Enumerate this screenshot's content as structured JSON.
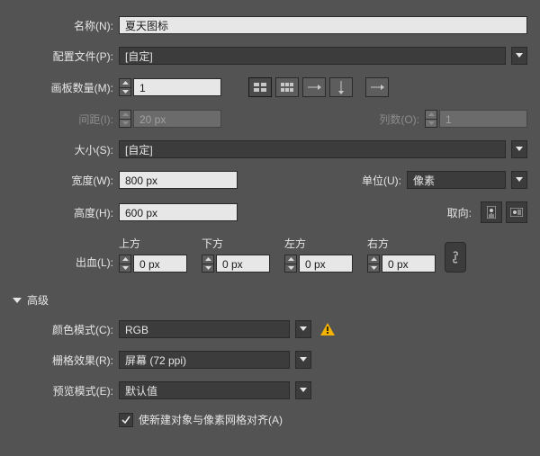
{
  "labels": {
    "name": "名称(N):",
    "profile": "配置文件(P):",
    "artboards": "画板数量(M):",
    "spacing": "间距(I):",
    "cols": "列数(O):",
    "size": "大小(S):",
    "width": "宽度(W):",
    "units": "单位(U):",
    "height": "高度(H):",
    "orient": "取向:",
    "bleed": "出血(L):",
    "top": "上方",
    "bottom": "下方",
    "left": "左方",
    "right": "右方",
    "advanced": "高级",
    "colormode": "颜色模式(C):",
    "raster": "栅格效果(R):",
    "preview": "预览模式(E):",
    "aligncheck": "使新建对象与像素网格对齐(A)"
  },
  "values": {
    "name": "夏天图标",
    "profile": "[自定]",
    "artboards": "1",
    "spacing": "20 px",
    "cols": "1",
    "size": "[自定]",
    "width": "800 px",
    "units": "像素",
    "height": "600 px",
    "bleed_top": "0 px",
    "bleed_bottom": "0 px",
    "bleed_left": "0 px",
    "bleed_right": "0 px",
    "colormode": "RGB",
    "raster": "屏幕 (72 ppi)",
    "preview": "默认值"
  }
}
